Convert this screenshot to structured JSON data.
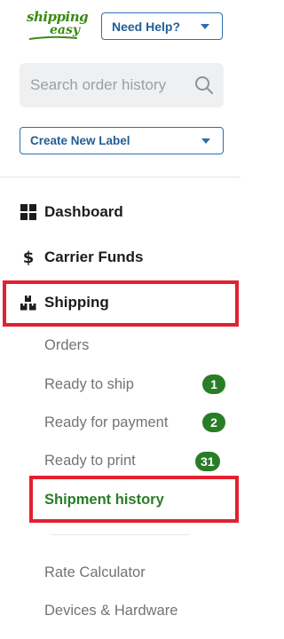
{
  "logo": {
    "line1": "shipping",
    "line2": "easy"
  },
  "header": {
    "help_label": "Need Help?"
  },
  "search": {
    "placeholder": "Search order history",
    "value": ""
  },
  "create_label": "Create New Label",
  "nav": {
    "dashboard": "Dashboard",
    "carrier_funds": "Carrier Funds",
    "shipping": "Shipping",
    "carrier_funds_icon": "$"
  },
  "shipping_sub": {
    "orders": "Orders",
    "ready_to_ship": {
      "label": "Ready to ship",
      "count": "1"
    },
    "ready_for_payment": {
      "label": "Ready for payment",
      "count": "2"
    },
    "ready_to_print": {
      "label": "Ready to print",
      "count": "31"
    },
    "shipment_history": "Shipment history"
  },
  "other": {
    "rate_calculator": "Rate Calculator",
    "devices_hardware": "Devices & Hardware"
  },
  "colors": {
    "brand_green": "#2a7d27",
    "button_blue": "#2c6fad",
    "highlight_red": "#e3202e"
  },
  "icons": {
    "dashboard": "grid-icon",
    "carrier_funds": "dollar-icon",
    "shipping": "boxes-icon",
    "search": "search-icon",
    "dropdown": "caret-down-icon"
  }
}
